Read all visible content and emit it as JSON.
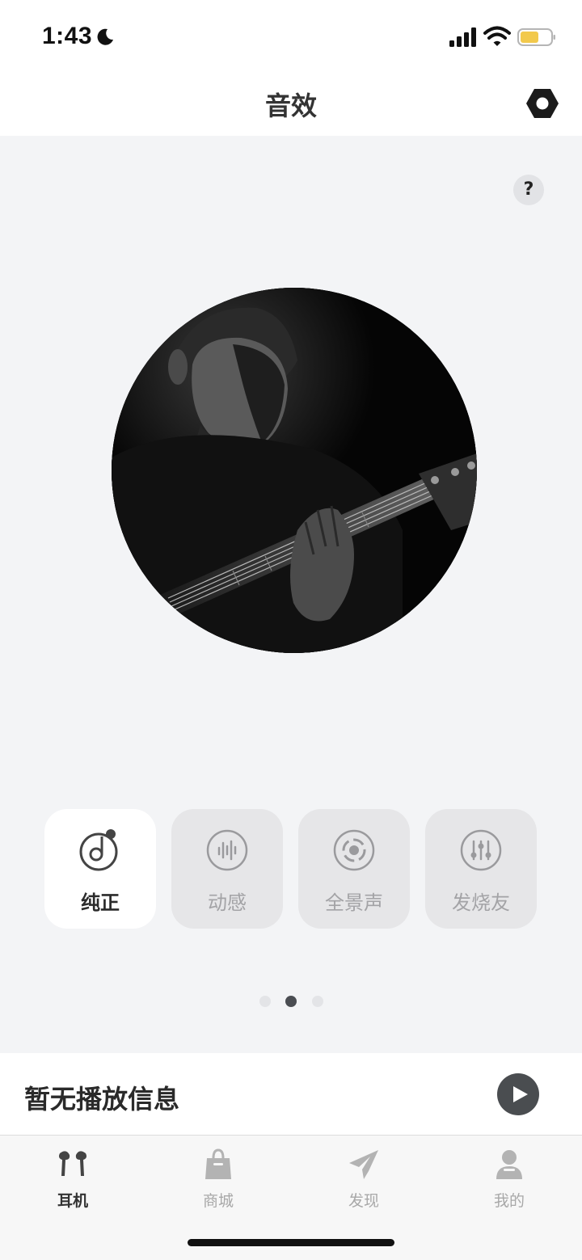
{
  "status_bar": {
    "time": "1:43"
  },
  "nav": {
    "title": "音效"
  },
  "help": {
    "label": "?"
  },
  "sound_modes": [
    {
      "label": "纯正",
      "icon": "music-note-icon",
      "active": true
    },
    {
      "label": "动感",
      "icon": "waveform-icon",
      "active": false
    },
    {
      "label": "全景声",
      "icon": "surround-icon",
      "active": false
    },
    {
      "label": "发烧友",
      "icon": "equalizer-icon",
      "active": false
    }
  ],
  "pager": {
    "page_count": 3,
    "current_page": 2
  },
  "now_playing": {
    "text": "暂无播放信息"
  },
  "tabs": [
    {
      "label": "耳机",
      "icon": "earbuds-icon",
      "active": true
    },
    {
      "label": "商城",
      "icon": "shopping-bag-icon",
      "active": false
    },
    {
      "label": "发现",
      "icon": "paper-plane-icon",
      "active": false
    },
    {
      "label": "我的",
      "icon": "user-icon",
      "active": false
    }
  ],
  "colors": {
    "background": "#f3f4f6",
    "active_card": "#ffffff",
    "inactive_card": "#e6e6e8",
    "accent_dark": "#4a4d50",
    "battery": "#f2c94c"
  }
}
